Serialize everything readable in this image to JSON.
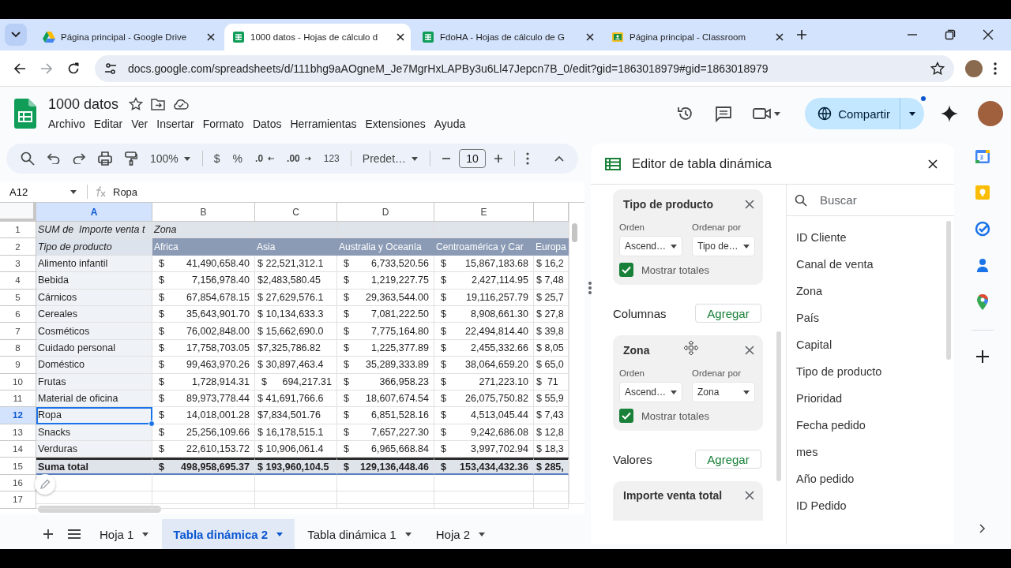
{
  "browser": {
    "tabs": [
      {
        "kind": "drive",
        "title": "Página principal - Google Drive",
        "selected": false
      },
      {
        "kind": "sheets",
        "title": "1000 datos - Hojas de cálculo d",
        "selected": true
      },
      {
        "kind": "sheets",
        "title": "FdoHA - Hojas de cálculo de G",
        "selected": false
      },
      {
        "kind": "classroom",
        "title": "Página principal - Classroom",
        "selected": false
      }
    ],
    "url": "docs.google.com/spreadsheets/d/111bhg9aAOgneM_Je7MgrHxLAPBy3u6Ll47Jepcn7B_0/edit?gid=1863018979#gid=1863018979"
  },
  "document": {
    "title": "1000 datos",
    "menu": [
      "Archivo",
      "Editar",
      "Ver",
      "Insertar",
      "Formato",
      "Datos",
      "Herramientas",
      "Extensiones",
      "Ayuda"
    ],
    "share": "Compartir"
  },
  "toolbar": {
    "zoom": "100%",
    "currency": "$",
    "percent": "%",
    "decrease_decimals": ".0",
    "increase_decimals": ".00",
    "number_format": "123",
    "font": "Predet…",
    "font_size": "10"
  },
  "formula_bar": {
    "cell": "A12",
    "value": "Ropa"
  },
  "sheet": {
    "columns": [
      {
        "label": "A",
        "selected": true
      },
      {
        "label": "B",
        "selected": false
      },
      {
        "label": "C",
        "selected": false
      },
      {
        "label": "D",
        "selected": false
      },
      {
        "label": "E",
        "selected": false
      }
    ],
    "row_numbers": [
      {
        "label": "1",
        "selected": false
      },
      {
        "label": "2",
        "selected": false
      },
      {
        "label": "3",
        "selected": false
      },
      {
        "label": "4",
        "selected": false
      },
      {
        "label": "5",
        "selected": false
      },
      {
        "label": "6",
        "selected": false
      },
      {
        "label": "7",
        "selected": false
      },
      {
        "label": "8",
        "selected": false
      },
      {
        "label": "9",
        "selected": false
      },
      {
        "label": "10",
        "selected": false
      },
      {
        "label": "11",
        "selected": false
      },
      {
        "label": "12",
        "selected": true
      },
      {
        "label": "13",
        "selected": false
      },
      {
        "label": "14",
        "selected": false
      },
      {
        "label": "15",
        "selected": false
      },
      {
        "label": "16",
        "selected": false
      },
      {
        "label": "17",
        "selected": false
      }
    ]
  },
  "pivot": {
    "title_row": {
      "value_label": "SUM de  Importe venta t",
      "column_field": "Zona"
    },
    "header": {
      "label": "Tipo de producto",
      "zones": [
        "Africa",
        "Asia",
        "Australia y Oceanía",
        "Centroamérica y Car",
        "Europa"
      ]
    },
    "rows": [
      {
        "label": "Alimento infantil",
        "selected": false,
        "cells": [
          {
            "sign": "$",
            "amount": "41,490,658.40"
          },
          {
            "text": "$ 22,521,312.1"
          },
          {
            "sign": "$",
            "amount": "6,733,520.56"
          },
          {
            "sign": "$",
            "amount": "15,867,183.68"
          },
          {
            "text": "$ 16,2"
          }
        ]
      },
      {
        "label": "Bebida",
        "selected": false,
        "cells": [
          {
            "sign": "$",
            "amount": "7,156,978.40"
          },
          {
            "text": "$2,483,580.45"
          },
          {
            "sign": "$",
            "amount": "1,219,227.75"
          },
          {
            "sign": "$",
            "amount": "2,427,114.95"
          },
          {
            "text": "$ 7,48"
          }
        ]
      },
      {
        "label": "Cárnicos",
        "selected": false,
        "cells": [
          {
            "sign": "$",
            "amount": "67,854,678.15"
          },
          {
            "text": "$ 27,629,576.1"
          },
          {
            "sign": "$",
            "amount": "29,363,544.00"
          },
          {
            "sign": "$",
            "amount": "19,116,257.79"
          },
          {
            "text": "$ 25,7"
          }
        ]
      },
      {
        "label": "Cereales",
        "selected": false,
        "cells": [
          {
            "sign": "$",
            "amount": "35,643,901.70"
          },
          {
            "text": "$ 10,134,633.3"
          },
          {
            "sign": "$",
            "amount": "7,081,222.50"
          },
          {
            "sign": "$",
            "amount": "8,908,661.30"
          },
          {
            "text": "$ 27,8"
          }
        ]
      },
      {
        "label": "Cosméticos",
        "selected": false,
        "cells": [
          {
            "sign": "$",
            "amount": "76,002,848.00"
          },
          {
            "text": "$ 15,662,690.0"
          },
          {
            "sign": "$",
            "amount": "7,775,164.80"
          },
          {
            "sign": "$",
            "amount": "22,494,814.40"
          },
          {
            "text": "$ 39,8"
          }
        ]
      },
      {
        "label": "Cuidado personal",
        "selected": false,
        "cells": [
          {
            "sign": "$",
            "amount": "17,758,703.05"
          },
          {
            "text": "$7,325,786.82"
          },
          {
            "sign": "$",
            "amount": "1,225,377.89"
          },
          {
            "sign": "$",
            "amount": "2,455,332.66"
          },
          {
            "text": "$ 8,05"
          }
        ]
      },
      {
        "label": "Doméstico",
        "selected": false,
        "cells": [
          {
            "sign": "$",
            "amount": "99,463,970.26"
          },
          {
            "text": "$ 30,897,463.4"
          },
          {
            "sign": "$",
            "amount": "35,289,333.89"
          },
          {
            "sign": "$",
            "amount": "38,064,659.20"
          },
          {
            "text": "$ 65,0"
          }
        ]
      },
      {
        "label": "Frutas",
        "selected": false,
        "cells": [
          {
            "sign": "$",
            "amount": "1,728,914.31"
          },
          {
            "sign": "$",
            "amount": "694,217.31"
          },
          {
            "sign": "$",
            "amount": "366,958.23"
          },
          {
            "sign": "$",
            "amount": "271,223.10"
          },
          {
            "text": "$  71"
          }
        ]
      },
      {
        "label": "Material de oficina",
        "selected": false,
        "cells": [
          {
            "sign": "$",
            "amount": "89,973,778.44"
          },
          {
            "text": "$ 41,691,766.6"
          },
          {
            "sign": "$",
            "amount": "18,607,674.54"
          },
          {
            "sign": "$",
            "amount": "26,075,750.82"
          },
          {
            "text": "$ 55,9"
          }
        ]
      },
      {
        "label": "Ropa",
        "selected": true,
        "cells": [
          {
            "sign": "$",
            "amount": "14,018,001.28"
          },
          {
            "text": "$7,834,501.76"
          },
          {
            "sign": "$",
            "amount": "6,851,528.16"
          },
          {
            "sign": "$",
            "amount": "4,513,045.44"
          },
          {
            "text": "$ 7,43"
          }
        ]
      },
      {
        "label": "Snacks",
        "selected": false,
        "cells": [
          {
            "sign": "$",
            "amount": "25,256,109.66"
          },
          {
            "text": "$ 16,178,515.1"
          },
          {
            "sign": "$",
            "amount": "7,657,227.30"
          },
          {
            "sign": "$",
            "amount": "9,242,686.08"
          },
          {
            "text": "$ 12,8"
          }
        ]
      },
      {
        "label": "Verduras",
        "selected": false,
        "cells": [
          {
            "sign": "$",
            "amount": "22,610,153.72"
          },
          {
            "text": "$ 10,906,061.4"
          },
          {
            "sign": "$",
            "amount": "6,965,668.84"
          },
          {
            "sign": "$",
            "amount": "3,997,702.94"
          },
          {
            "text": "$ 18,3"
          }
        ]
      }
    ],
    "total": {
      "label": "Suma total",
      "cells": [
        {
          "sign": "$",
          "amount": "498,958,695.37"
        },
        {
          "text": "$ 193,960,104.5"
        },
        {
          "sign": "$",
          "amount": "129,136,448.46"
        },
        {
          "sign": "$",
          "amount": "153,434,432.36"
        },
        {
          "text": "$ 285,"
        }
      ]
    }
  },
  "sheet_tabs": [
    {
      "label": "Hoja 1",
      "selected": false
    },
    {
      "label": "Tabla dinámica 2",
      "selected": true
    },
    {
      "label": "Tabla dinámica 1",
      "selected": false
    },
    {
      "label": "Hoja 2",
      "selected": false
    }
  ],
  "pivot_editor": {
    "title": "Editor de tabla dinámica",
    "sections": [
      {
        "kind": "card",
        "field": "Tipo de producto",
        "order_label": "Orden",
        "order": "Ascend…",
        "sort_label": "Ordenar por",
        "sort": "Tipo de…",
        "totals_label": "Mostrar totales",
        "show_totals": true
      },
      {
        "kind": "header",
        "label": "Columnas",
        "add": "Agregar"
      },
      {
        "kind": "card",
        "field": "Zona",
        "order_label": "Orden",
        "order": "Ascend…",
        "sort_label": "Ordenar por",
        "sort": "Zona",
        "totals_label": "Mostrar totales",
        "show_totals": true
      },
      {
        "kind": "header",
        "label": "Valores",
        "add": "Agregar"
      },
      {
        "kind": "stub",
        "field": "Importe venta total"
      }
    ],
    "search_placeholder": "Buscar",
    "fields": [
      "ID Cliente",
      "Canal de venta",
      "Zona",
      "País",
      "Capital",
      "Tipo de producto",
      "Prioridad",
      "Fecha pedido",
      "mes",
      "Año pedido",
      "ID Pedido"
    ]
  }
}
